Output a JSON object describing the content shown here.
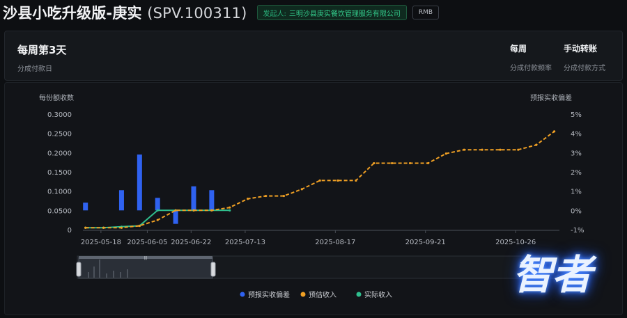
{
  "header": {
    "title": "沙县小吃升级版-庚实",
    "code": "(SPV.100311)",
    "issuer_label": "发起人:",
    "issuer_name": "三明沙县庚实餐饮管理服务有限公司",
    "currency": "RMB"
  },
  "info": {
    "payday_value": "每周第3天",
    "payday_label": "分成付款日",
    "frequency_value": "每周",
    "frequency_label": "分成付款频率",
    "method_value": "手动转账",
    "method_label": "分成付款方式"
  },
  "chart_data": {
    "type": "bar+line",
    "left_axis_title": "每份额收数",
    "right_axis_title": "预报实收偏差",
    "left_ticks": [
      "0.3000",
      "0.2500",
      "0.2000",
      "0.1500",
      "0.1000",
      "0.0500",
      "0"
    ],
    "right_ticks": [
      "5%",
      "4%",
      "3%",
      "2%",
      "1%",
      "0%",
      "-1%"
    ],
    "x_ticks": [
      "2025-05-18",
      "2025-06-05",
      "2025-06-22",
      "2025-07-13",
      "2025-08-17",
      "2025-09-21",
      "2025-10-26"
    ],
    "left_ylim": [
      0,
      0.3
    ],
    "right_ylim": [
      -1,
      5
    ],
    "xlim": [
      "2025-05-11",
      "2025-11-12"
    ],
    "bars": {
      "name": "预报实收偏差",
      "color": "#2f62f0",
      "points": [
        {
          "x": "2025-05-12",
          "y": 0.4
        },
        {
          "x": "2025-05-26",
          "y": 1.05
        },
        {
          "x": "2025-06-02",
          "y": 2.9
        },
        {
          "x": "2025-06-09",
          "y": 0.65
        },
        {
          "x": "2025-06-16",
          "y": -0.7
        },
        {
          "x": "2025-06-23",
          "y": 1.25
        },
        {
          "x": "2025-06-30",
          "y": 1.05
        }
      ]
    },
    "estimated": {
      "name": "预估收入",
      "color": "#f0a024",
      "points": [
        {
          "x": "2025-05-12",
          "y": -0.9
        },
        {
          "x": "2025-05-19",
          "y": -0.9
        },
        {
          "x": "2025-05-26",
          "y": -0.9
        },
        {
          "x": "2025-06-02",
          "y": -0.8
        },
        {
          "x": "2025-06-09",
          "y": -0.5
        },
        {
          "x": "2025-06-16",
          "y": 0
        },
        {
          "x": "2025-06-23",
          "y": 0
        },
        {
          "x": "2025-06-30",
          "y": 0
        },
        {
          "x": "2025-07-07",
          "y": 0.15
        },
        {
          "x": "2025-07-14",
          "y": 0.6
        },
        {
          "x": "2025-07-21",
          "y": 0.75
        },
        {
          "x": "2025-07-28",
          "y": 0.75
        },
        {
          "x": "2025-08-04",
          "y": 1.1
        },
        {
          "x": "2025-08-11",
          "y": 1.55
        },
        {
          "x": "2025-08-18",
          "y": 1.55
        },
        {
          "x": "2025-08-25",
          "y": 1.55
        },
        {
          "x": "2025-09-01",
          "y": 2.45
        },
        {
          "x": "2025-09-08",
          "y": 2.45
        },
        {
          "x": "2025-09-15",
          "y": 2.45
        },
        {
          "x": "2025-09-22",
          "y": 2.45
        },
        {
          "x": "2025-09-29",
          "y": 2.95
        },
        {
          "x": "2025-10-06",
          "y": 3.15
        },
        {
          "x": "2025-10-13",
          "y": 3.15
        },
        {
          "x": "2025-10-20",
          "y": 3.15
        },
        {
          "x": "2025-10-27",
          "y": 3.15
        },
        {
          "x": "2025-11-03",
          "y": 3.4
        },
        {
          "x": "2025-11-10",
          "y": 4.1
        }
      ]
    },
    "actual": {
      "name": "实际收入",
      "color": "#2fbf8e",
      "points": [
        {
          "x": "2025-05-12",
          "y": -0.9
        },
        {
          "x": "2025-05-19",
          "y": -0.9
        },
        {
          "x": "2025-05-26",
          "y": -0.85
        },
        {
          "x": "2025-06-02",
          "y": -0.8
        },
        {
          "x": "2025-06-09",
          "y": 0
        },
        {
          "x": "2025-06-16",
          "y": 0
        },
        {
          "x": "2025-06-23",
          "y": 0
        },
        {
          "x": "2025-06-30",
          "y": 0
        },
        {
          "x": "2025-07-07",
          "y": 0
        }
      ]
    },
    "legend": [
      {
        "name": "预报实收偏差",
        "color": "#2f62f0"
      },
      {
        "name": "预估收入",
        "color": "#f0a024"
      },
      {
        "name": "实际收入",
        "color": "#2fbf8e"
      }
    ],
    "legend_position": "bottom-center",
    "grid": false
  },
  "watermark_text": "智者"
}
